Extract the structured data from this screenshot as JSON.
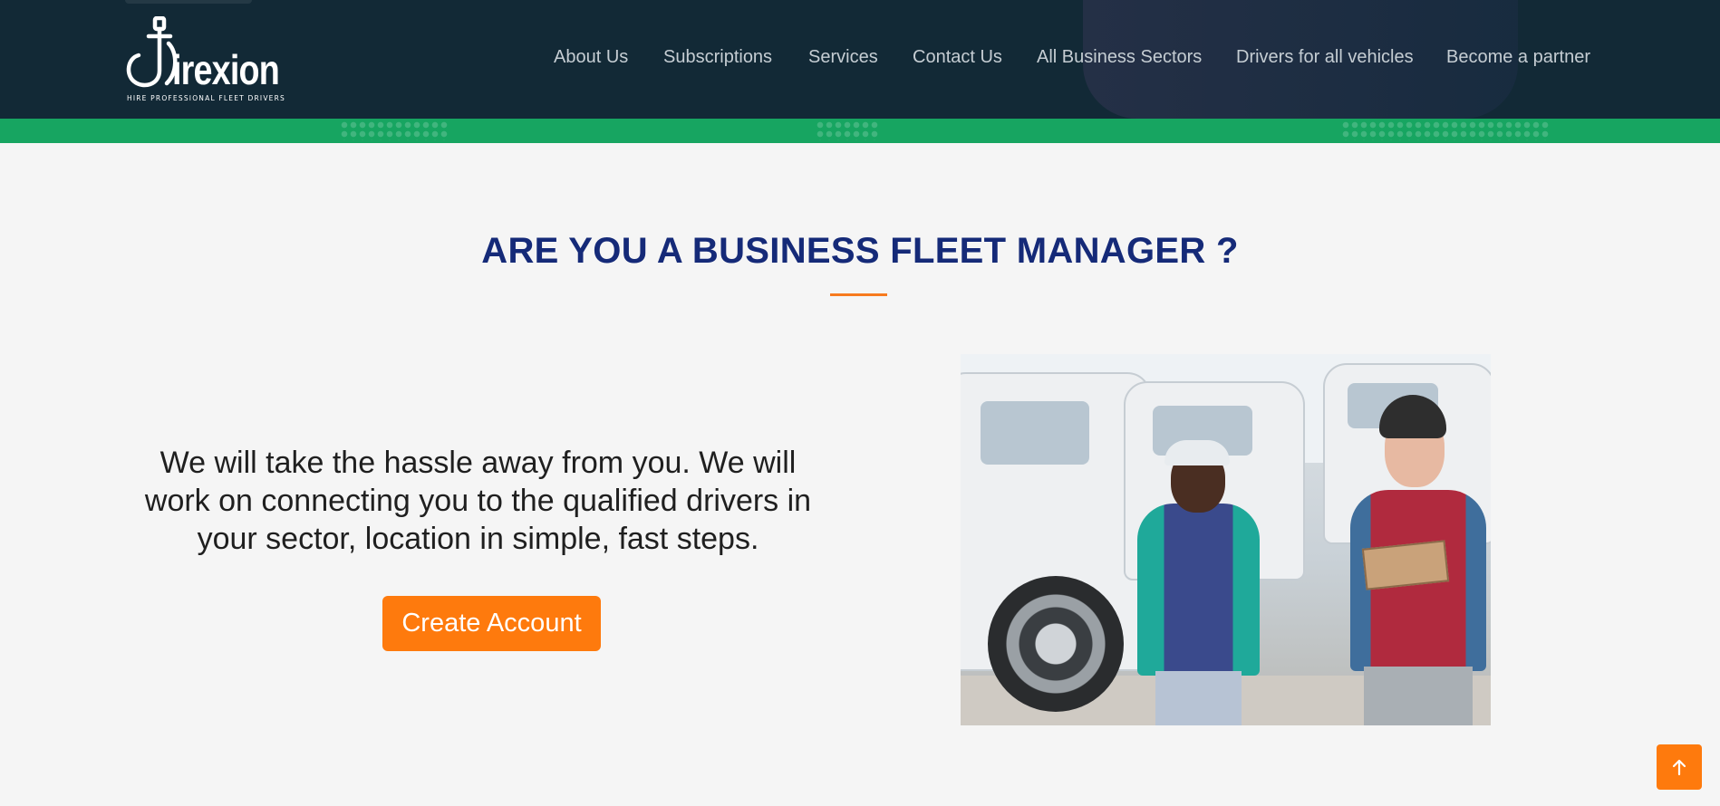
{
  "brand": {
    "name": "irexion",
    "tagline": "HIRE PROFESSIONAL FLEET DRIVERS"
  },
  "nav": {
    "items": [
      {
        "label": "About Us"
      },
      {
        "label": "Subscriptions"
      },
      {
        "label": "Services"
      },
      {
        "label": "Contact Us"
      },
      {
        "label": "All Business Sectors"
      },
      {
        "label": "Drivers for all vehicles"
      },
      {
        "label": "Become a partner"
      }
    ]
  },
  "section": {
    "title": "ARE YOU A BUSINESS FLEET MANAGER ?",
    "lead": "We will take the hassle away from you. We will work on connecting you to the qualified drivers in your sector, location in simple, fast steps.",
    "cta_label": "Create Account"
  },
  "icons": {
    "back_to_top": "arrow-up-icon",
    "logo": "fleet-driver-logo-icon"
  },
  "colors": {
    "header_bg": "#122936",
    "accent_green": "#17a561",
    "accent_orange": "#fe7a0d",
    "title_blue": "#152a78"
  }
}
